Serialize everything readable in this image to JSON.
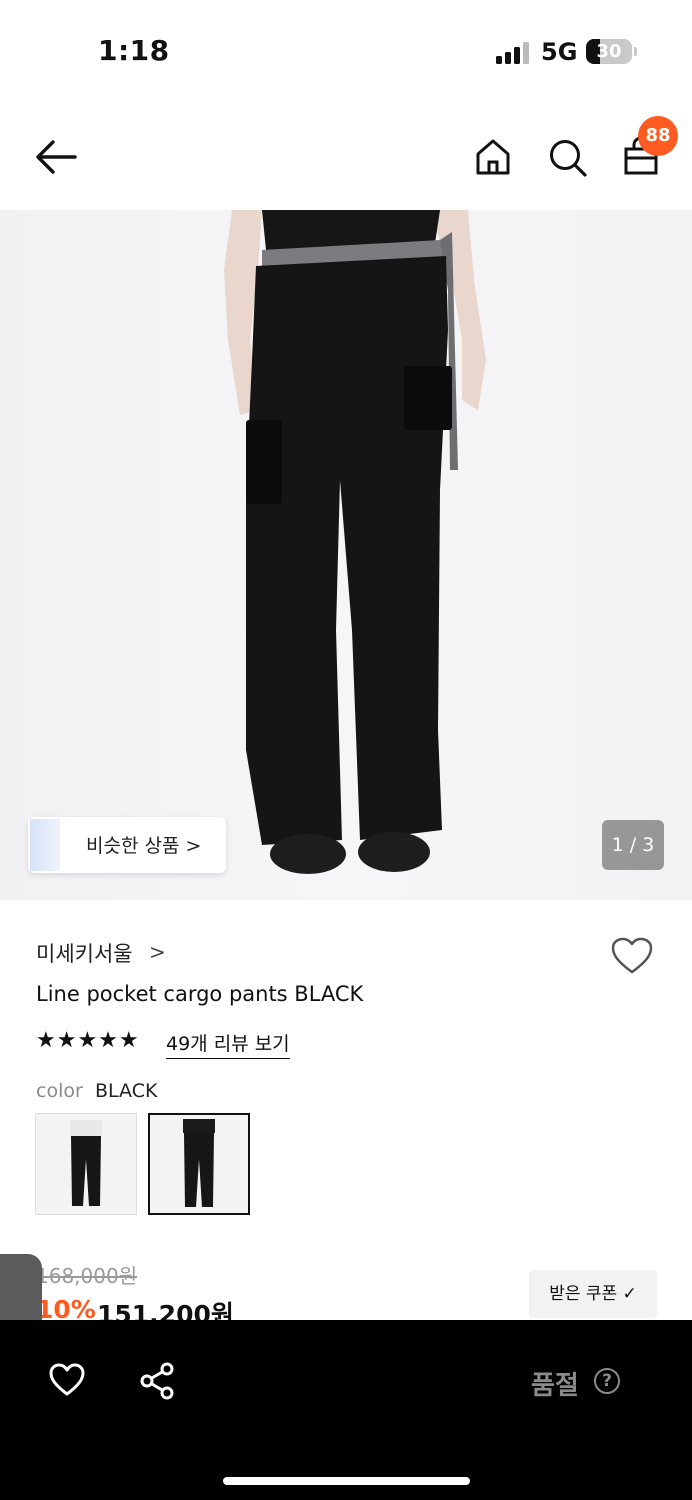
{
  "status_bar": {
    "time": "1:18",
    "network": "5G",
    "battery": "30",
    "battery_level": 0.3
  },
  "header": {
    "back_icon": "arrow-left-icon",
    "home_icon": "home-icon",
    "search_icon": "search-icon",
    "cart_icon": "shopping-bag-icon",
    "cart_count": "88"
  },
  "gallery": {
    "similar_label": "비슷한 상품 >",
    "counter": "1 / 3"
  },
  "product": {
    "brand": "미세키서울",
    "brand_chevron": ">",
    "title": "Line pocket cargo pants BLACK",
    "stars": "★★★★★",
    "rating": 5,
    "review_link": "49개 리뷰 보기",
    "color_label": "color",
    "color_value": "BLACK",
    "original_price": "168,000원",
    "discount": "10%",
    "sale_price": "151,200원",
    "coupon_label": "받은 쿠폰 ✓"
  },
  "side_tab": {
    "label": "〉"
  },
  "bottom_bar": {
    "like_icon": "heart-icon",
    "share_icon": "share-icon",
    "soldout_label": "품절",
    "help_label": "?"
  },
  "colors": {
    "accent": "#ff5a1f",
    "bottom_bar": "#000000",
    "muted": "#8a8a8a"
  }
}
